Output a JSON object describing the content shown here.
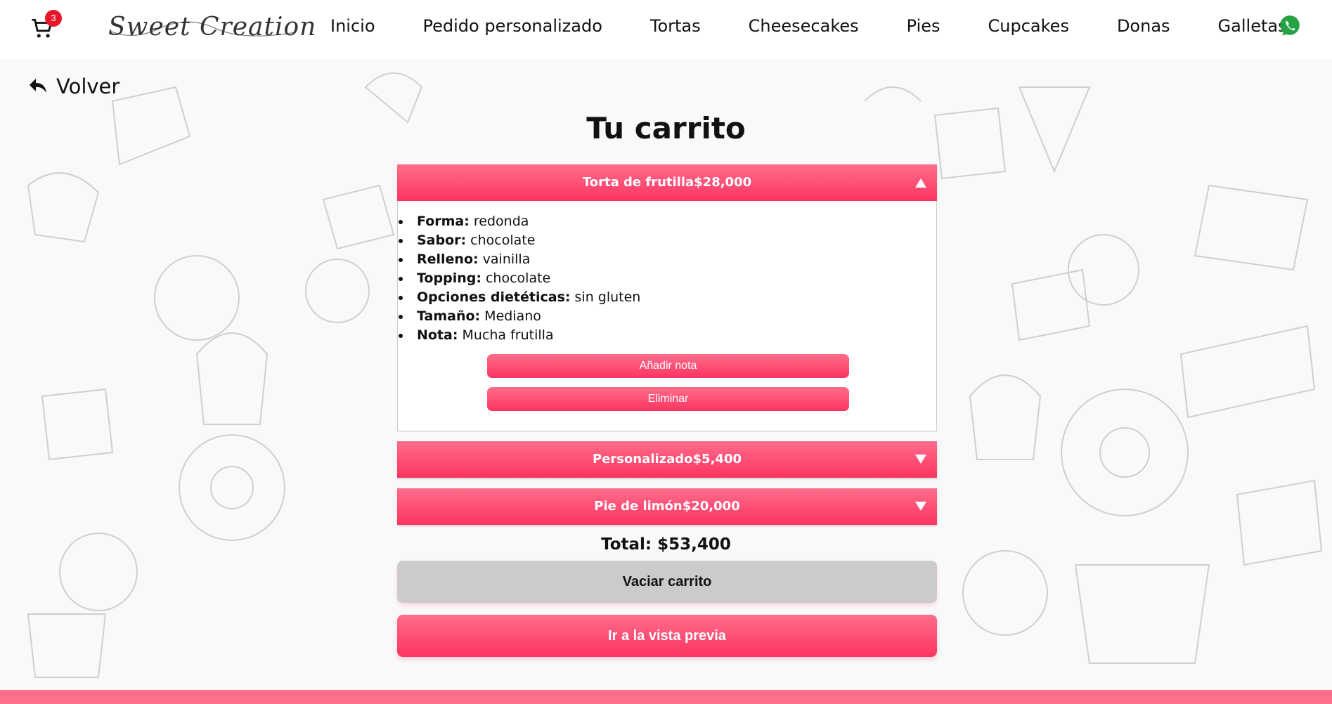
{
  "header": {
    "cart_count": "3",
    "logo_text": "Sweet Creation",
    "nav": [
      {
        "label": "Inicio"
      },
      {
        "label": "Pedido personalizado"
      },
      {
        "label": "Tortas"
      },
      {
        "label": "Cheesecakes"
      },
      {
        "label": "Pies"
      },
      {
        "label": "Cupcakes"
      },
      {
        "label": "Donas"
      },
      {
        "label": "Galletas"
      }
    ]
  },
  "back_label": "Volver",
  "page_title": "Tu carrito",
  "cart": {
    "items": [
      {
        "title": "Torta de frutilla$28,000",
        "expanded": true,
        "details": [
          {
            "key": "Forma:",
            "value": " redonda"
          },
          {
            "key": "Sabor:",
            "value": " chocolate"
          },
          {
            "key": "Relleno:",
            "value": " vainilla"
          },
          {
            "key": "Topping:",
            "value": " chocolate"
          },
          {
            "key": "Opciones dietéticas:",
            "value": " sin gluten"
          },
          {
            "key": "Tamaño:",
            "value": " Mediano"
          },
          {
            "key": "Nota:",
            "value": " Mucha frutilla"
          }
        ],
        "add_note_label": "Añadir nota",
        "delete_label": "Eliminar"
      },
      {
        "title": "Personalizado$5,400",
        "expanded": false
      },
      {
        "title": "Pie de limón$20,000",
        "expanded": false
      }
    ],
    "total": "Total: $53,400",
    "empty_label": "Vaciar carrito",
    "preview_label": "Ir a la vista previa"
  },
  "colors": {
    "accent": "#fc3462",
    "accent_light": "#ff6d8b",
    "badge": "#e6172a",
    "whatsapp": "#25a244",
    "footer": "#ff6e8a"
  },
  "icons": [
    "cart-icon",
    "whatsapp-icon",
    "back-arrow-icon",
    "chevron-up-icon",
    "chevron-down-icon"
  ]
}
